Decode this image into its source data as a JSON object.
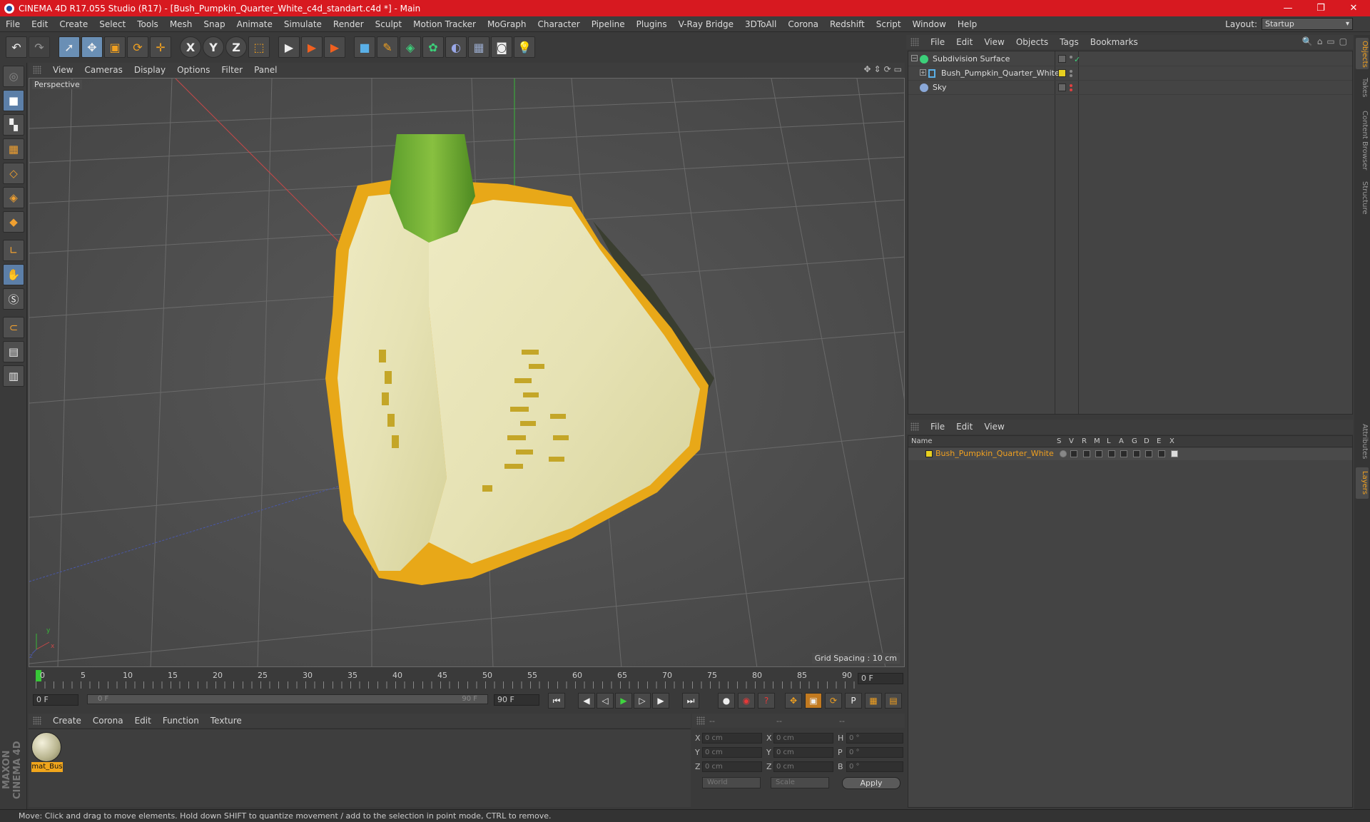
{
  "titlebar": {
    "title": "CINEMA 4D R17.055 Studio (R17) - [Bush_Pumpkin_Quarter_White_c4d_standart.c4d *] - Main",
    "minimize": "—",
    "maximize": "❐",
    "close": "✕"
  },
  "menubar": {
    "items": [
      "File",
      "Edit",
      "Create",
      "Select",
      "Tools",
      "Mesh",
      "Snap",
      "Animate",
      "Simulate",
      "Render",
      "Sculpt",
      "Motion Tracker",
      "MoGraph",
      "Character",
      "Pipeline",
      "Plugins",
      "V-Ray Bridge",
      "3DToAll",
      "Corona",
      "Redshift",
      "Script",
      "Window",
      "Help"
    ],
    "layout_label": "Layout:",
    "layout_value": "Startup"
  },
  "toolbar": {
    "undo": "↶",
    "redo": "↷",
    "select": "➚",
    "move": "✥",
    "scale": "▣",
    "rotate": "⟳",
    "last": "✛",
    "axis_x": "X",
    "axis_y": "Y",
    "axis_z": "Z",
    "coord": "⬚",
    "render_view": "▶",
    "render_pic": "▶",
    "render_settings": "▶",
    "cube": "■",
    "pen": "✎",
    "subdiv": "◈",
    "mograph": "✿",
    "deformer": "◐",
    "floor": "▦",
    "camera": "◙",
    "light": "💡"
  },
  "left_palette": {
    "maxon_logo": "MAXON CINEMA 4D"
  },
  "viewport": {
    "menu": [
      "View",
      "Cameras",
      "Display",
      "Options",
      "Filter",
      "Panel"
    ],
    "nav_icons": [
      "✥",
      "⇕",
      "⟳",
      "▭"
    ],
    "camera_label": "Perspective",
    "grid_spacing": "Grid Spacing : 10 cm",
    "axis_y": "y",
    "axis_x": "x",
    "axis_z": "z"
  },
  "timeline": {
    "ticks": [
      "0",
      "5",
      "10",
      "15",
      "20",
      "25",
      "30",
      "35",
      "40",
      "45",
      "50",
      "55",
      "60",
      "65",
      "70",
      "75",
      "80",
      "85",
      "90"
    ],
    "current_frame": "0 F",
    "start_frame": "0 F",
    "range_start": "0 F",
    "range_end": "90 F",
    "end_frame": "90 F"
  },
  "transport": {
    "first": "⏮",
    "prev_key": "◀",
    "prev": "◁",
    "play": "▶",
    "next": "▷",
    "next_key": "▶",
    "last": "⏭",
    "record": "●",
    "auto_key": "◉",
    "help": "?",
    "key_move": "✥",
    "key_scale": "▣",
    "key_rotate": "⟳",
    "key_param": "P",
    "key_pla": "▦",
    "timeline_btn": "▤"
  },
  "materials": {
    "menu": [
      "Create",
      "Corona",
      "Edit",
      "Function",
      "Texture"
    ],
    "items": [
      {
        "name": "mat_Bus"
      }
    ]
  },
  "coordinates": {
    "head": [
      "--",
      "--",
      "--"
    ],
    "rows": [
      {
        "a1": "X",
        "v1": "0 cm",
        "a2": "X",
        "v2": "0 cm",
        "a3": "H",
        "v3": "0 °"
      },
      {
        "a1": "Y",
        "v1": "0 cm",
        "a2": "Y",
        "v2": "0 cm",
        "a3": "P",
        "v3": "0 °"
      },
      {
        "a1": "Z",
        "v1": "0 cm",
        "a2": "Z",
        "v2": "0 cm",
        "a3": "B",
        "v3": "0 °"
      }
    ],
    "space": "World",
    "mode": "Scale",
    "apply": "Apply"
  },
  "object_manager": {
    "menu": [
      "File",
      "Edit",
      "View",
      "Objects",
      "Tags",
      "Bookmarks"
    ],
    "objects": [
      {
        "name": "Subdivision Surface"
      },
      {
        "name": "Bush_Pumpkin_Quarter_White"
      },
      {
        "name": "Sky"
      }
    ],
    "tool_icons": [
      "🔍",
      "⌂",
      "▭",
      "▢"
    ]
  },
  "layer_manager": {
    "menu": [
      "File",
      "Edit",
      "View"
    ],
    "columns": [
      "Name",
      "S",
      "V",
      "R",
      "M",
      "L",
      "A",
      "G",
      "D",
      "E",
      "X"
    ],
    "layers": [
      {
        "name": "Bush_Pumpkin_Quarter_White"
      }
    ]
  },
  "right_tabs": [
    "Objects",
    "Takes",
    "Content Browser",
    "Structure",
    "Attributes",
    "Layers"
  ],
  "status": {
    "text": "Move: Click and drag to move elements. Hold down SHIFT to quantize movement / add to the selection in point mode, CTRL to remove."
  },
  "colors": {
    "title_red": "#d71920",
    "accent_orange": "#f0a020",
    "play_green": "#37c837",
    "layer_yellow": "#e8d020"
  }
}
